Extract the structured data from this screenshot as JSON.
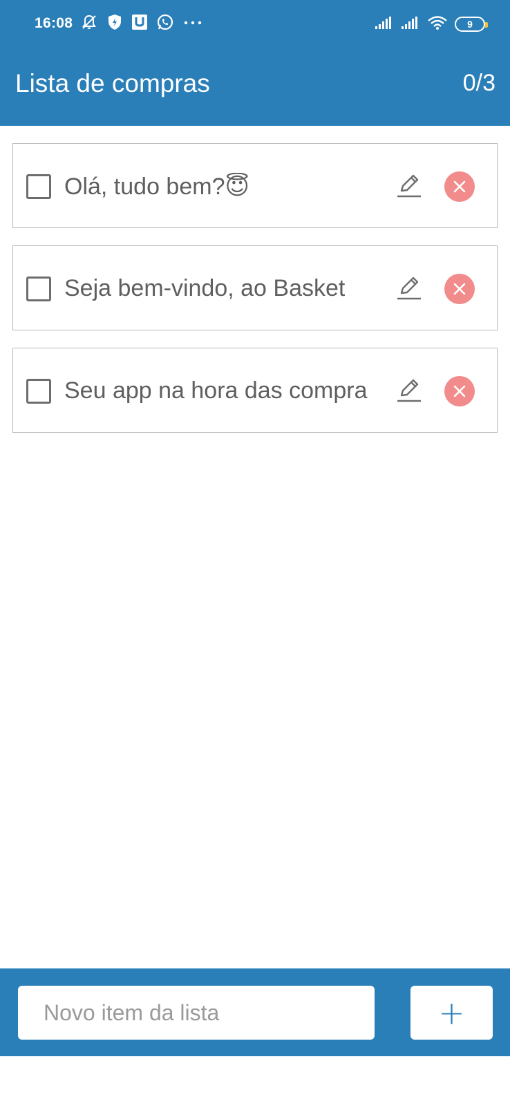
{
  "status_bar": {
    "time": "16:08",
    "icons_left": [
      "notifications-off-icon",
      "shield-bolt-icon",
      "u-app-icon",
      "whatsapp-icon",
      "more-dots-icon"
    ],
    "icons_right": [
      "signal-icon",
      "signal-icon",
      "wifi-icon",
      "battery-icon"
    ],
    "battery_level": "9"
  },
  "app_bar": {
    "title": "Lista de compras",
    "counter": "0/3"
  },
  "list": {
    "items": [
      {
        "text": "Olá, tudo bem?😇",
        "checked": false
      },
      {
        "text": "Seja bem-vindo, ao Basket",
        "checked": false
      },
      {
        "text": "Seu app na hora das compra",
        "checked": false
      }
    ]
  },
  "bottom_bar": {
    "input_placeholder": "Novo item da lista",
    "input_value": "",
    "add_label": "+"
  },
  "colors": {
    "primary": "#2b7fb8",
    "delete": "#f28b8b",
    "text": "#5f5f5f"
  }
}
